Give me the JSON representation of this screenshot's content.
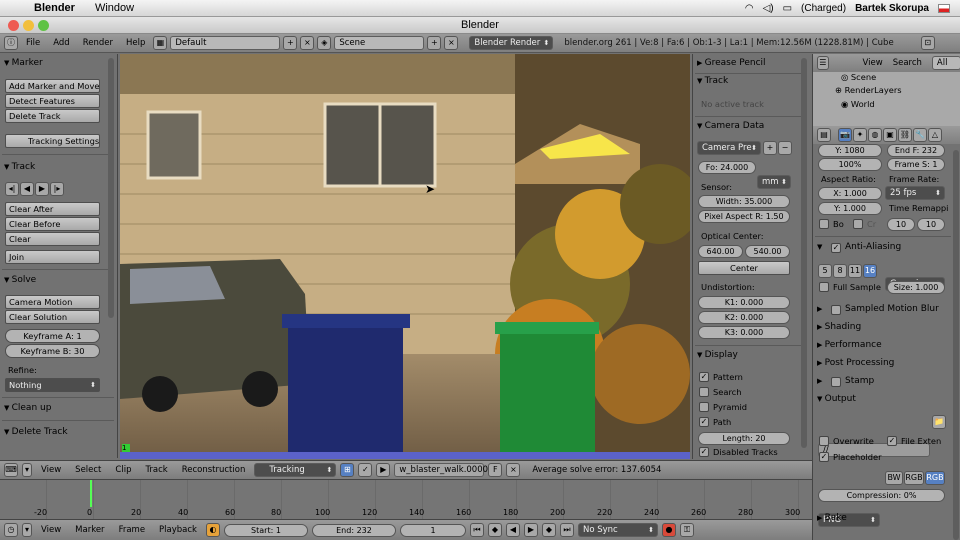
{
  "mac": {
    "app": "Blender",
    "menu_window": "Window",
    "battery": "(Charged)",
    "user": "Bartek Skorupa"
  },
  "window": {
    "title": "Blender"
  },
  "info_header": {
    "menus": [
      "File",
      "Add",
      "Render",
      "Help"
    ],
    "screen": "Default",
    "scene": "Scene",
    "engine": "Blender Render",
    "stats": "blender.org 261 | Ve:8 | Fa:6 | Ob:1-3 | La:1 | Mem:12.56M (1228.81M) | Cube"
  },
  "left": {
    "marker_title": "Marker",
    "add_marker": "Add Marker and Move",
    "detect": "Detect Features",
    "delete_track": "Delete Track",
    "tracking_settings": "Tracking Settings",
    "track_title": "Track",
    "clear_after": "Clear After",
    "clear_before": "Clear Before",
    "clear": "Clear",
    "join": "Join",
    "solve_title": "Solve",
    "camera_motion": "Camera Motion",
    "clear_solution": "Clear Solution",
    "keyframe_a": "Keyframe A: 1",
    "keyframe_b": "Keyframe B: 30",
    "refine_label": "Refine:",
    "refine_value": "Nothing",
    "cleanup_title": "Clean up",
    "delete_track_title": "Delete Track"
  },
  "mid": {
    "grease_pencil": "Grease Pencil",
    "track_title": "Track",
    "no_active": "No active track",
    "camera_title": "Camera Data",
    "camera_preset": "Camera Pre",
    "focal": "Fo: 24.000",
    "unit": "mm",
    "sensor_label": "Sensor:",
    "width": "Width: 35.000",
    "pixel_aspect": "Pixel Aspect R: 1.50",
    "optical_label": "Optical Center:",
    "oc_x": "640.00",
    "oc_y": "540.00",
    "center": "Center",
    "undistortion_label": "Undistortion:",
    "k1": "K1: 0.000",
    "k2": "K2: 0.000",
    "k3": "K3: 0.000",
    "display_title": "Display",
    "pattern": "Pattern",
    "search": "Search",
    "pyramid": "Pyramid",
    "path": "Path",
    "length": "Length: 20",
    "disabled_tracks": "Disabled Tracks"
  },
  "outliner": {
    "view": "View",
    "search": "Search",
    "all_scenes": "All Scen",
    "scene": "Scene",
    "renderlayers": "RenderLayers",
    "world": "World"
  },
  "props": {
    "res_y": "Y: 1080",
    "end_f": "End F: 232",
    "percent": "100%",
    "frame_step": "Frame S: 1",
    "aspect_label": "Aspect Ratio:",
    "framerate_label": "Frame Rate:",
    "ax": "X: 1.000",
    "fps": "25 fps",
    "ay": "Y: 1.000",
    "time_remap": "Time Remappi",
    "bo": "Bo",
    "cr": "Cr",
    "remap_a": "10",
    "remap_b": "10",
    "aa_title": "Anti-Aliasing",
    "aa_levels": [
      "5",
      "8",
      "11",
      "16"
    ],
    "filter": "Gaussian",
    "full_sample": "Full Sample",
    "size": "Size: 1.000",
    "smb": "Sampled Motion Blur",
    "shading": "Shading",
    "performance": "Performance",
    "post": "Post Processing",
    "stamp": "Stamp",
    "output": "Output",
    "path": "//",
    "overwrite": "Overwrite",
    "file_ext": "File Exten",
    "placeholder": "Placeholder",
    "format": "PNG",
    "bw": "BW",
    "rgb": "RGB",
    "rgba": "RGB",
    "compression": "Compression: 0%",
    "bake": "Bake"
  },
  "clipbar": {
    "menus": [
      "View",
      "Select",
      "Clip",
      "Track",
      "Reconstruction"
    ],
    "mode": "Tracking",
    "clip": "w_blaster_walk.0000",
    "f": "F",
    "solve_error": "Average solve error: 137.6054"
  },
  "timeline": {
    "ticks": [
      "-20",
      "0",
      "20",
      "40",
      "60",
      "80",
      "100",
      "120",
      "140",
      "160",
      "180",
      "200",
      "220",
      "240",
      "260",
      "280",
      "300"
    ],
    "menus": [
      "View",
      "Marker",
      "Frame",
      "Playback"
    ],
    "start": "Start: 1",
    "end": "End: 232",
    "current": "1",
    "sync": "No Sync"
  },
  "colors": {
    "accent": "#5680c2",
    "panel": "#727272",
    "header": "#8a8a8a"
  }
}
